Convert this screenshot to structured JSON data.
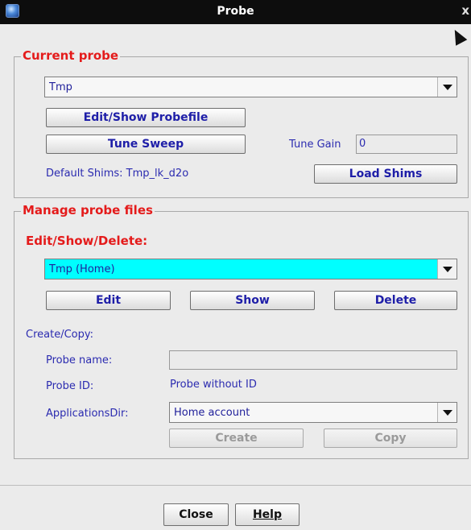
{
  "window": {
    "title": "Probe",
    "close_glyph": "x"
  },
  "current_probe": {
    "legend": "Current probe",
    "probe_select": "Tmp",
    "edit_show_button": "Edit/Show Probefile",
    "tune_sweep_button": "Tune Sweep",
    "tune_gain_label": "Tune Gain",
    "tune_gain_value": "0",
    "default_shims": "Default Shims: Tmp_lk_d2o",
    "load_shims_button": "Load Shims"
  },
  "manage": {
    "legend": "Manage probe files",
    "eds_label": "Edit/Show/Delete:",
    "probe_file_select": "Tmp  (Home)",
    "edit_button": "Edit",
    "show_button": "Show",
    "delete_button": "Delete",
    "create_copy_label": "Create/Copy:",
    "probe_name_label": "Probe name:",
    "probe_name_value": "",
    "probe_id_label": "Probe ID:",
    "probe_id_value": "Probe without ID",
    "apps_dir_label": "ApplicationsDir:",
    "apps_dir_select": "Home account",
    "create_button": "Create",
    "copy_button": "Copy"
  },
  "footer": {
    "close_button": "Close",
    "help_button": "Help"
  },
  "colors": {
    "accent_red": "#e41b1b",
    "text_blue": "#2b2bb0",
    "selected_cyan": "#00ffff",
    "titlebar": "#0d0d0d"
  },
  "icons": {
    "app": "java-app-icon",
    "cursor": "mouse-pointer-icon"
  }
}
